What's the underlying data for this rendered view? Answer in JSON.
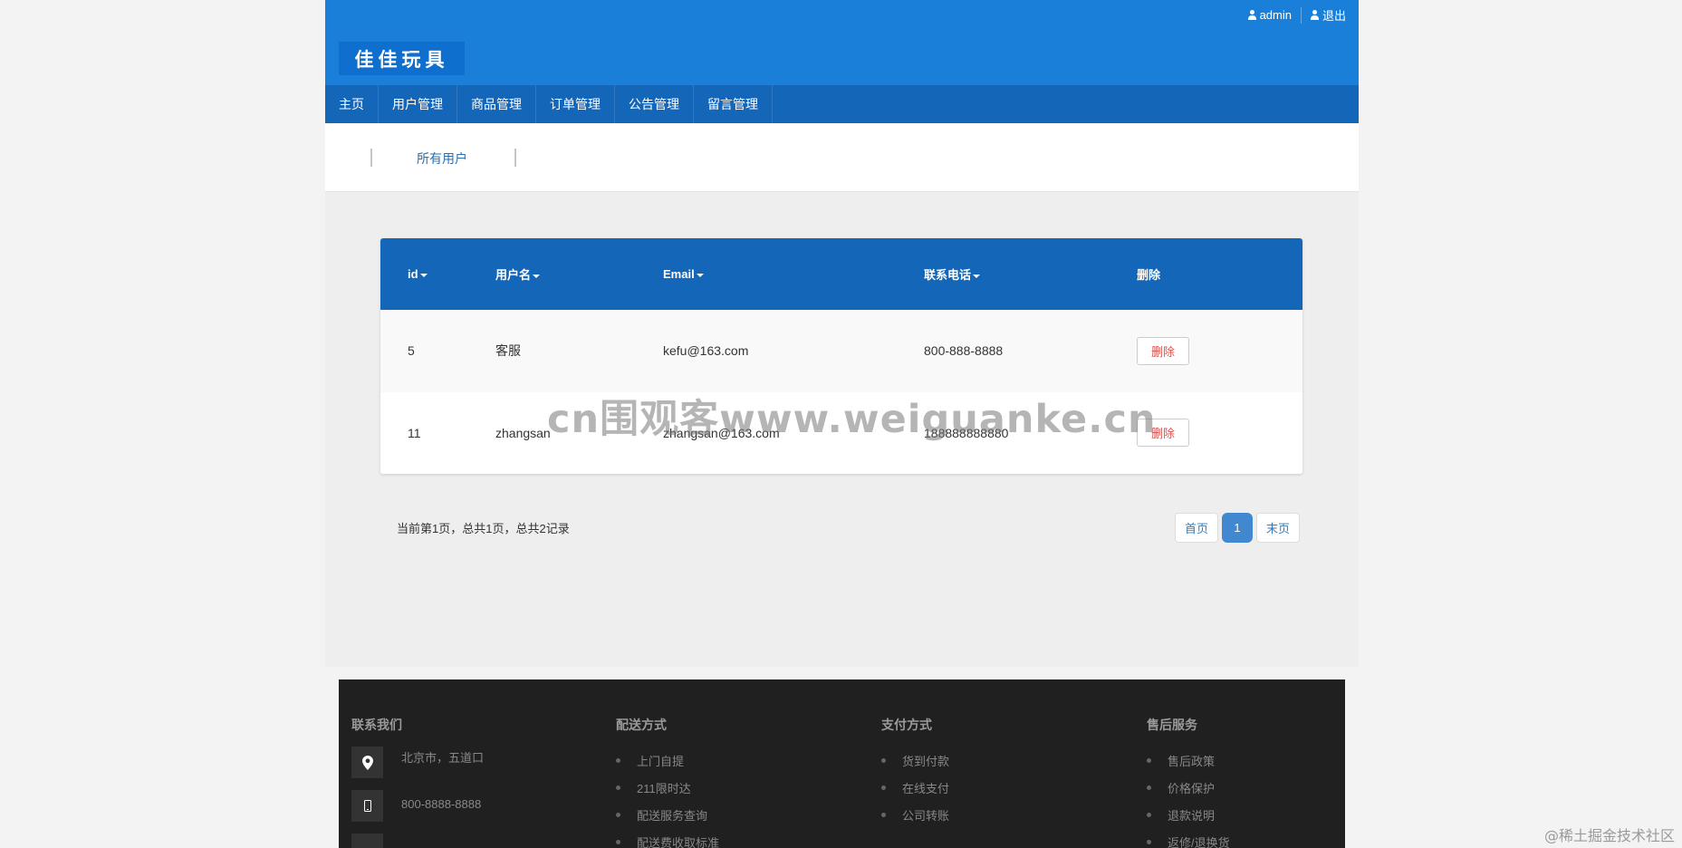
{
  "header": {
    "admin_label": "admin",
    "logout_label": "退出",
    "logo_text": "佳佳玩具"
  },
  "nav": {
    "items": [
      {
        "label": "主页"
      },
      {
        "label": "用户管理"
      },
      {
        "label": "商品管理"
      },
      {
        "label": "订单管理"
      },
      {
        "label": "公告管理"
      },
      {
        "label": "留言管理"
      }
    ]
  },
  "subnav": {
    "link_label": "所有用户"
  },
  "table": {
    "headers": [
      "id",
      "用户名",
      "Email",
      "联系电话",
      "删除"
    ],
    "rows": [
      {
        "id": "5",
        "username": "客服",
        "email": "kefu@163.com",
        "phone": "800-888-8888",
        "action": "删除"
      },
      {
        "id": "11",
        "username": "zhangsan",
        "email": "zhangsan@163.com",
        "phone": "188888888880",
        "action": "删除"
      }
    ]
  },
  "pagination": {
    "info": "当前第1页，总共1页，总共2记录",
    "first_label": "首页",
    "current_page": "1",
    "last_label": "末页"
  },
  "watermark": "cn围观客www.weiguanke.cn",
  "footer": {
    "contact": {
      "title": "联系我们",
      "address": "北京市，五道口",
      "phone": "800-8888-8888"
    },
    "delivery": {
      "title": "配送方式",
      "items": [
        "上门自提",
        "211限时达",
        "配送服务查询",
        "配送费收取标准"
      ]
    },
    "payment": {
      "title": "支付方式",
      "items": [
        "货到付款",
        "在线支付",
        "公司转账"
      ]
    },
    "aftersale": {
      "title": "售后服务",
      "items": [
        "售后政策",
        "价格保护",
        "退款说明",
        "返修/退换货"
      ]
    }
  },
  "credit": "@稀土掘金技术社区",
  "colors": {
    "header_blue": "#1a7fd8",
    "nav_blue": "#1466b8",
    "delete_red": "#d9534f",
    "pager_active": "#4188d0",
    "footer_dark": "#202020"
  }
}
